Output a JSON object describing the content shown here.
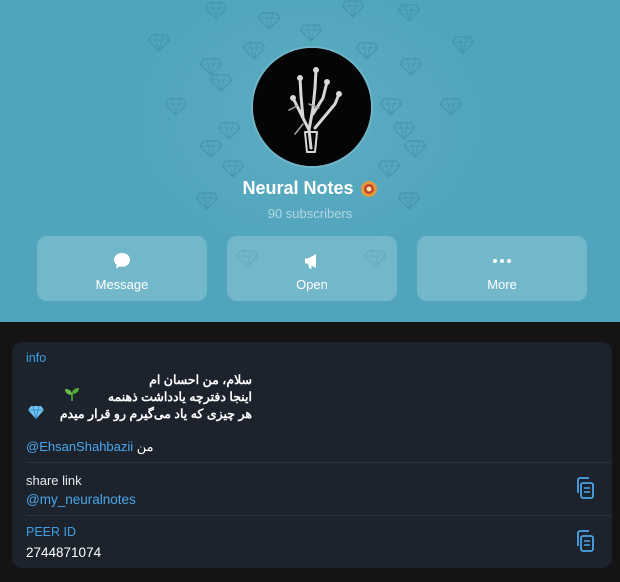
{
  "channel": {
    "title": "Neural Notes",
    "subscribers": "90 subscribers"
  },
  "actions": {
    "message_label": "Message",
    "open_label": "Open",
    "more_label": "More"
  },
  "info": {
    "section_label": "info",
    "bio_line_1": "سلام، من احسان ام",
    "bio_line_2": "اینجا دفترچه یادداشت ذهنمه",
    "bio_line_3": "هر چیزی که یاد می‌گیرم رو قرار میدم",
    "mention_prefix": "من",
    "mention_handle": "@EhsanShahbazii"
  },
  "share": {
    "label": "share link",
    "value": "@my_neuralnotes"
  },
  "peer": {
    "label": "PEER ID",
    "value": "2744871074"
  },
  "colors": {
    "header_bg": "#50a5bd",
    "card_bg": "#1c232c",
    "link": "#4aa6ea",
    "accent_label": "#3e9fe6"
  }
}
